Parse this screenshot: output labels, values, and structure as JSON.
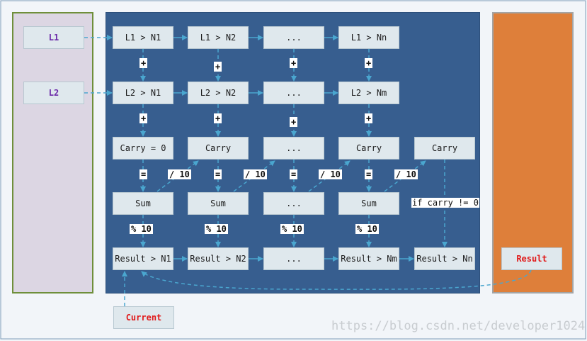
{
  "colors": {
    "left_panel": "#dcd6e3",
    "left_border": "#6f8f3b",
    "middle_panel": "#375e8f",
    "right_panel": "#de7f3a",
    "box": "#dfe8ed",
    "arrow": "#4aa6cf"
  },
  "inputs": {
    "l1": "L1",
    "l2": "L2"
  },
  "rows": {
    "l1": [
      "L1 > N1",
      "L1 > N2",
      "...",
      "L1 > Nn"
    ],
    "l2": [
      "L2 > N1",
      "L2 > N2",
      "...",
      "L2 > Nm"
    ],
    "carry": [
      "Carry = 0",
      "Carry",
      "...",
      "Carry",
      "Carry"
    ],
    "sum": [
      "Sum",
      "Sum",
      "...",
      "Sum"
    ],
    "result": [
      "Result > N1",
      "Result > N2",
      "...",
      "Result > Nm",
      "Result > Nn"
    ]
  },
  "operators": {
    "plus": "+",
    "equals": "=",
    "divide": "/ 10",
    "modulo": "% 10"
  },
  "condition": "if carry != 0",
  "result_label": "Result",
  "current_label": "Current",
  "watermark": "https://blog.csdn.net/developer1024"
}
